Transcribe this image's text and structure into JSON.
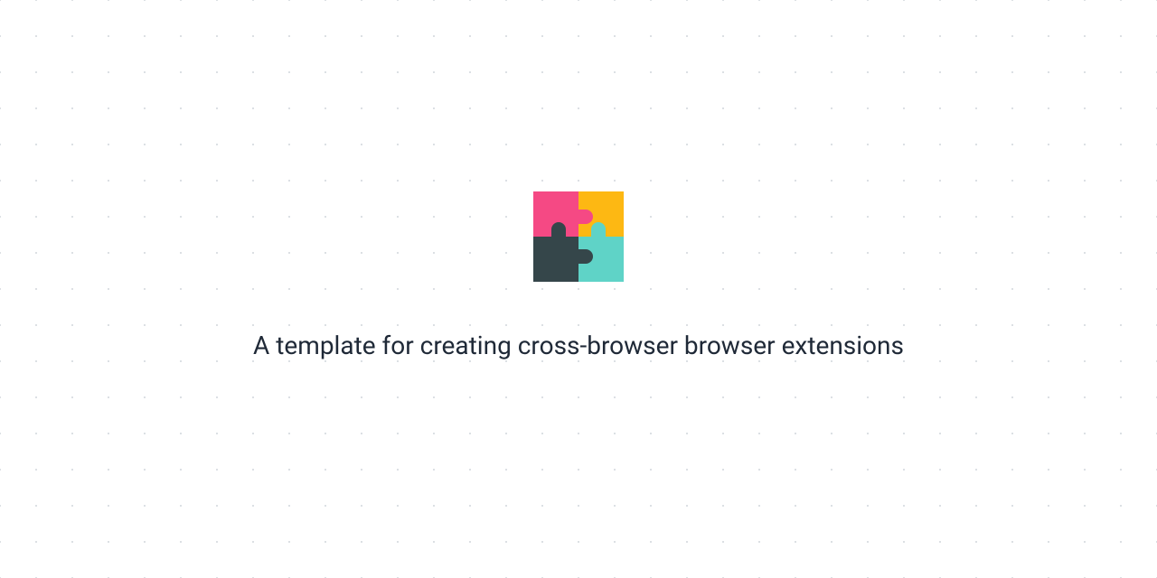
{
  "tagline": "A template for creating cross-browser browser extensions",
  "icon": {
    "name": "puzzle-piece",
    "colors": {
      "topLeft": "#f54984",
      "topRight": "#fdb813",
      "bottomLeft": "#35464a",
      "bottomRight": "#5fd3c7"
    }
  }
}
